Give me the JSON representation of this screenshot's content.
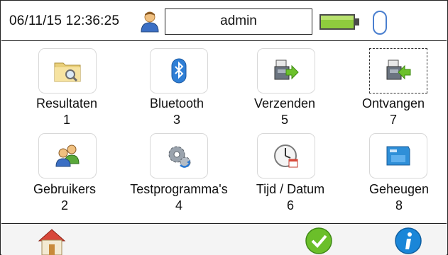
{
  "status_bar": {
    "datetime": "06/11/15 12:36:25",
    "user": "admin",
    "icons": [
      "user-icon",
      "battery-full-icon",
      "usb-icon"
    ]
  },
  "menu": {
    "items": [
      {
        "label": "Resultaten",
        "key": "1",
        "icon": "folder-search-icon"
      },
      {
        "label": "Bluetooth",
        "key": "3",
        "icon": "bluetooth-icon"
      },
      {
        "label": "Verzenden",
        "key": "5",
        "icon": "send-to-printer-icon"
      },
      {
        "label": "Ontvangen",
        "key": "7",
        "icon": "receive-from-device-icon"
      },
      {
        "label": "Gebruikers",
        "key": "2",
        "icon": "users-icon"
      },
      {
        "label": "Testprogramma's",
        "key": "4",
        "icon": "gears-icon"
      },
      {
        "label": "Tijd / Datum",
        "key": "6",
        "icon": "clock-calendar-icon"
      },
      {
        "label": "Geheugen",
        "key": "8",
        "icon": "microsd-card-icon"
      }
    ],
    "selected": "Ontvangen"
  },
  "bottom_bar": {
    "icons": [
      "home-icon",
      "confirm-check-icon",
      "info-icon"
    ]
  },
  "colors": {
    "accent_green": "#6bbf2a",
    "info_blue": "#1a86d8"
  }
}
